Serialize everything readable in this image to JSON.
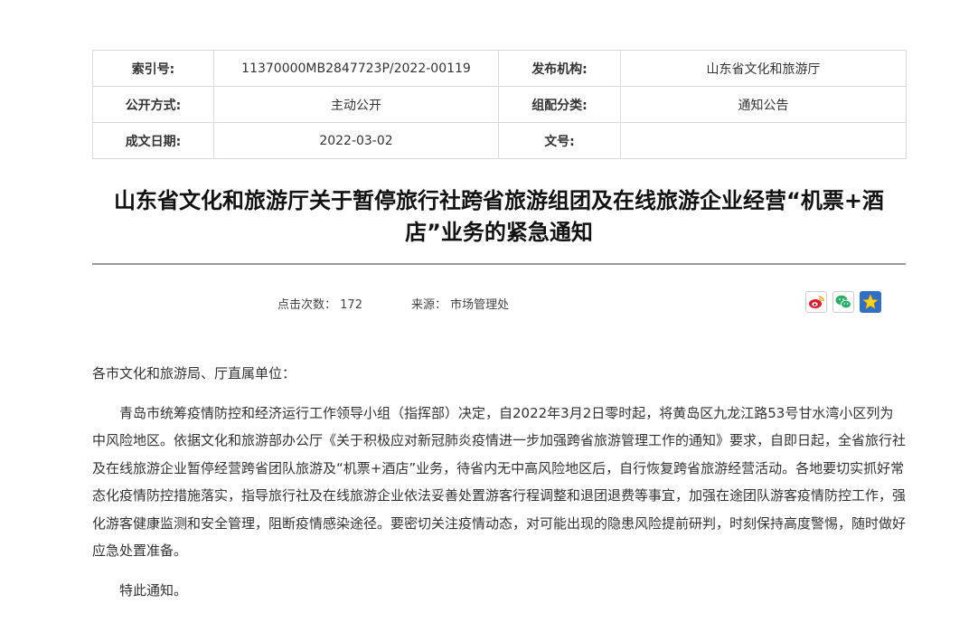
{
  "meta_table": {
    "row1": {
      "k1": "索引号:",
      "v1": "11370000MB2847723P/2022-00119",
      "k2": "发布机构:",
      "v2": "山东省文化和旅游厅"
    },
    "row2": {
      "k1": "公开方式:",
      "v1": "主动公开",
      "k2": "组配分类:",
      "v2": "通知公告"
    },
    "row3": {
      "k1": "成文日期:",
      "v1": "2022-03-02",
      "k2": "文号:",
      "v2": ""
    }
  },
  "title": "山东省文化和旅游厅关于暂停旅行社跨省旅游组团及在线旅游企业经营“机票+酒店”业务的紧急通知",
  "info": {
    "clicks_label": "点击次数：",
    "clicks_value": "172",
    "source_label": "来源：",
    "source_value": "市场管理处"
  },
  "share_icons": [
    "weibo-icon",
    "wechat-icon",
    "favorite-star-icon"
  ],
  "colors": {
    "star_bg": "#2f6fc4",
    "weibo_red": "#e6162d",
    "wechat_green": "#2aae67",
    "rule": "#999999"
  },
  "body": {
    "greeting": "各市文化和旅游局、厅直属单位：",
    "paragraph": "青岛市统筹疫情防控和经济运行工作领导小组（指挥部）决定，自2022年3月2日零时起，将黄岛区九龙江路53号甘水湾小区列为中风险地区。依据文化和旅游部办公厅《关于积极应对新冠肺炎疫情进一步加强跨省旅游管理工作的通知》要求，自即日起，全省旅行社及在线旅游企业暂停经营跨省团队旅游及“机票+酒店”业务，待省内无中高风险地区后，自行恢复跨省旅游经营活动。各地要切实抓好常态化疫情防控措施落实，指导旅行社及在线旅游企业依法妥善处置游客行程调整和退团退费等事宜，加强在途团队游客疫情防控工作，强化游客健康监测和安全管理，阻断疫情感染途径。要密切关注疫情动态，对可能出现的隐患风险提前研判，时刻保持高度警惕，随时做好应急处置准备。",
    "closing": "特此通知。"
  }
}
